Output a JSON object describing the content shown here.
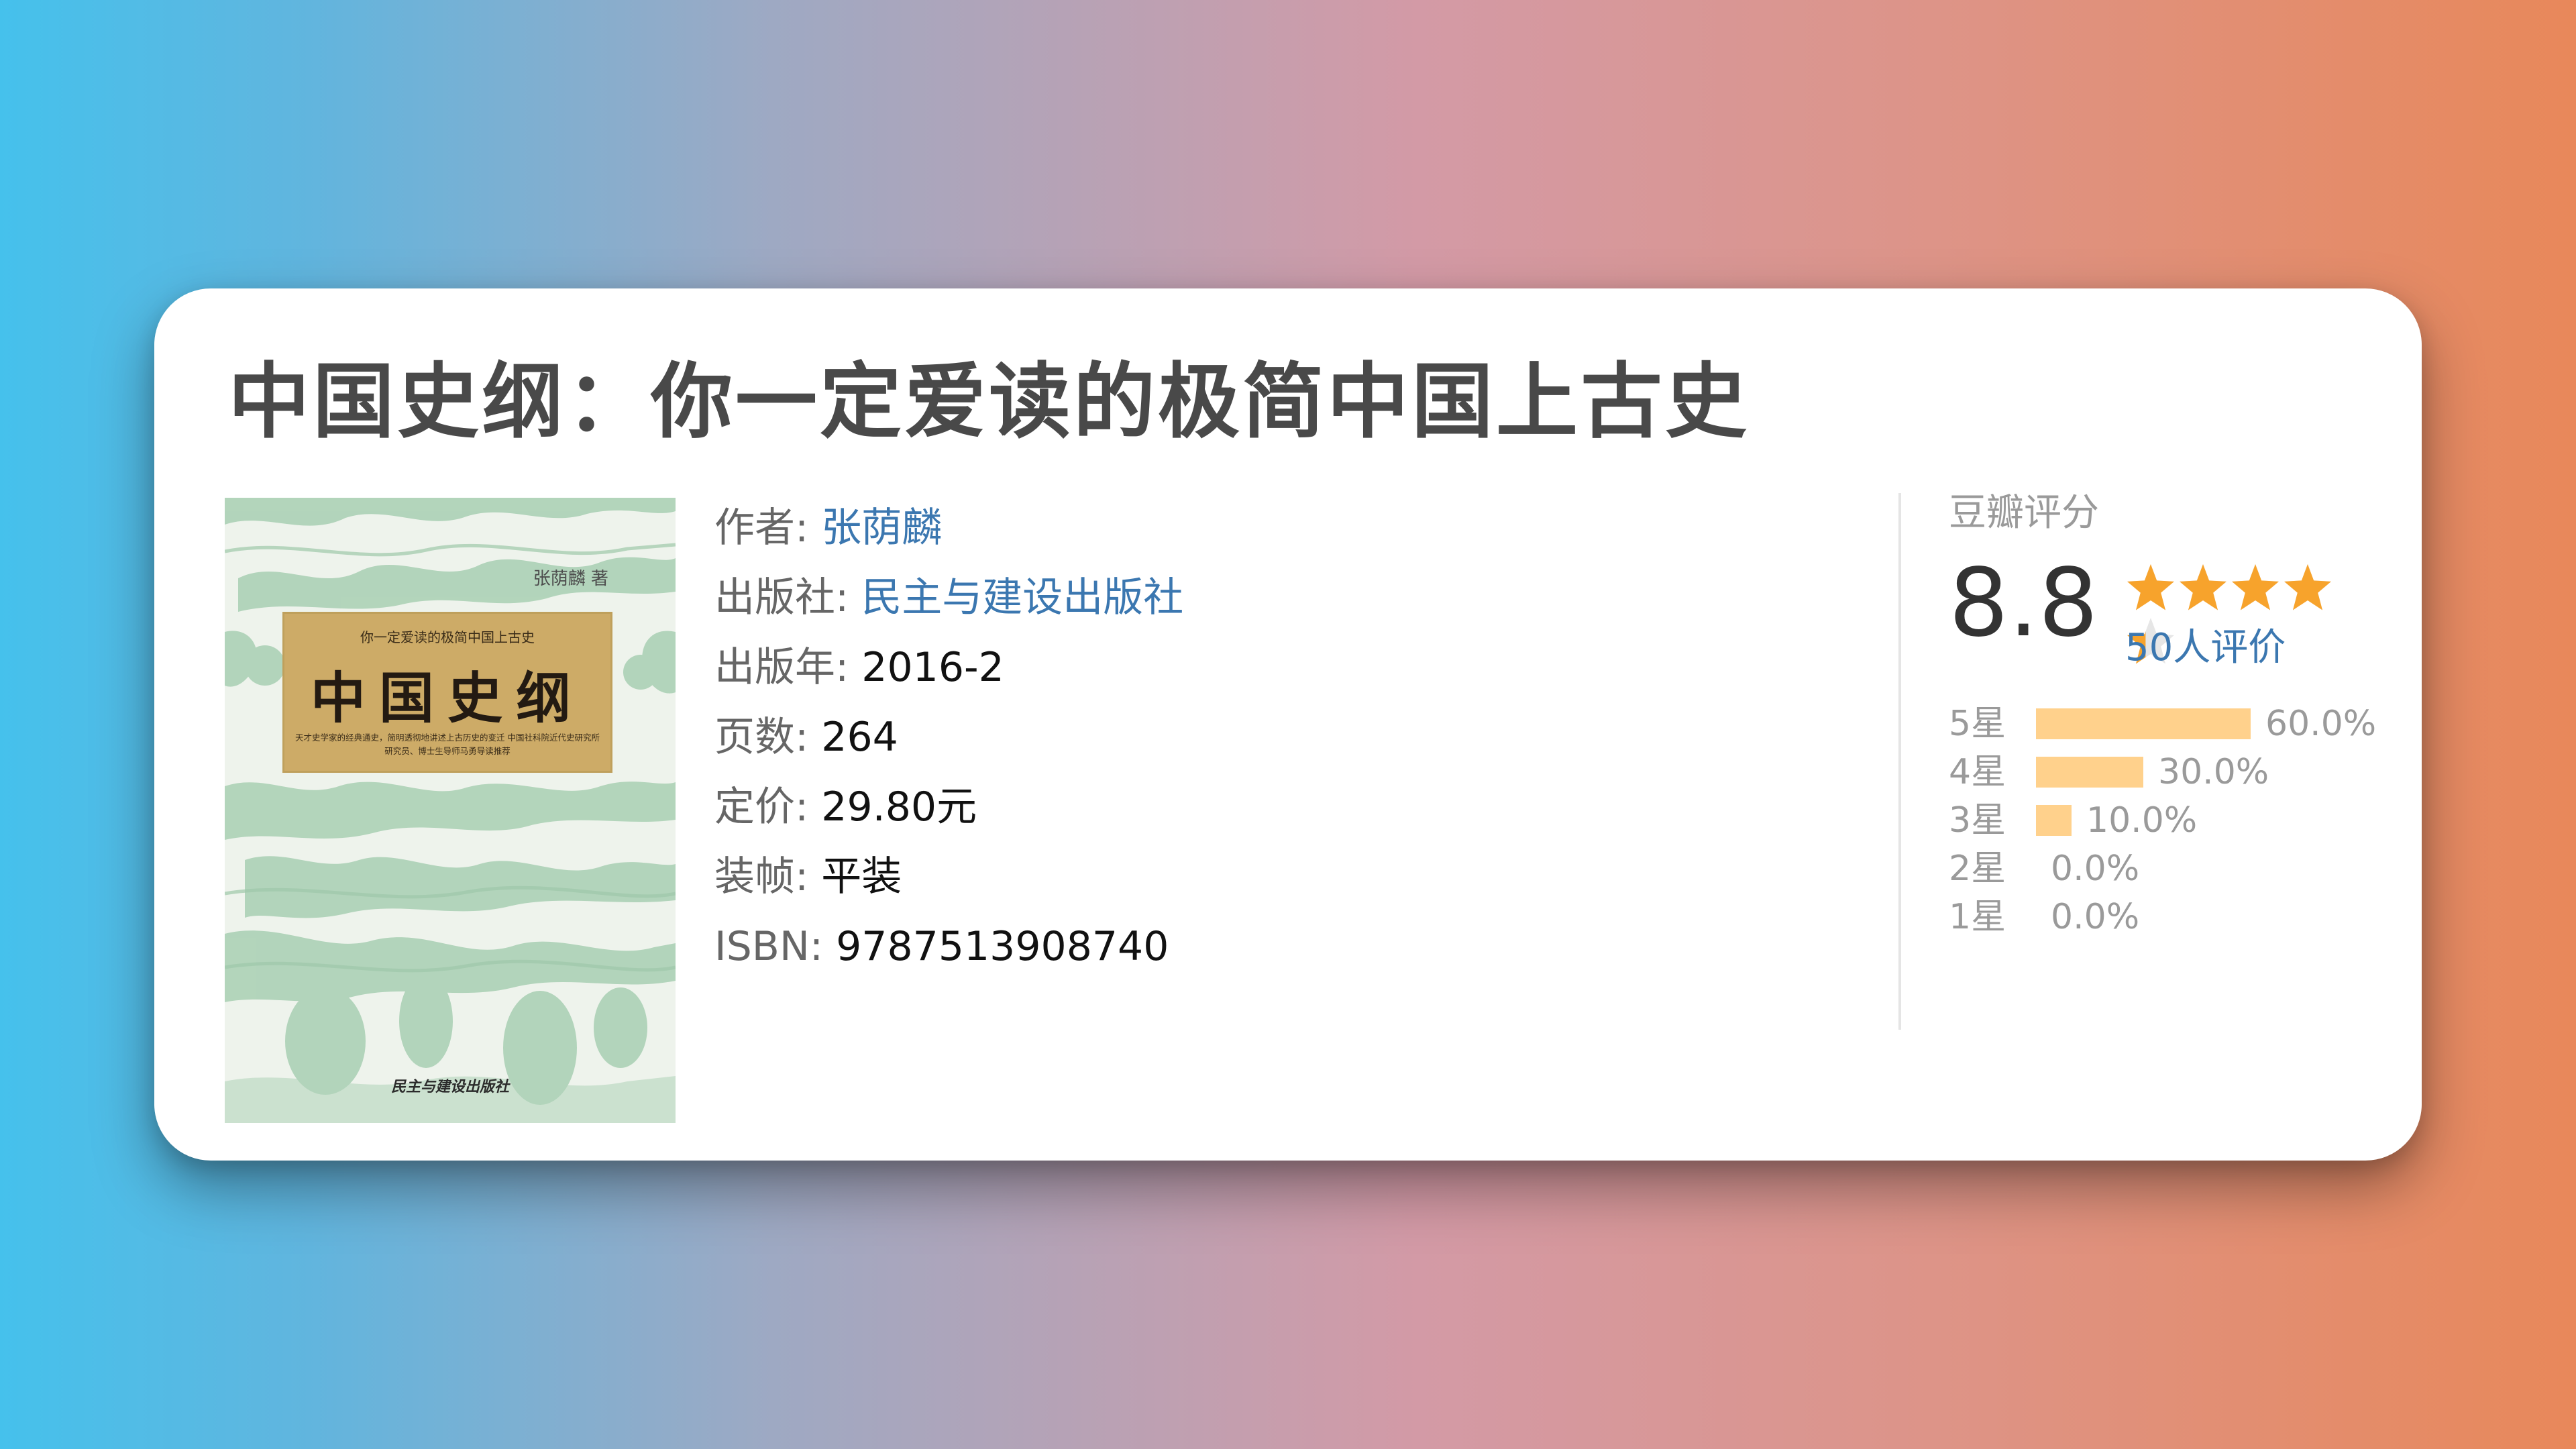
{
  "book": {
    "title": "中国史纲：你一定爱读的极简中国上古史",
    "author_label": "作者:",
    "author": "张荫麟",
    "publisher_label": "出版社:",
    "publisher": "民主与建设出版社",
    "year_label": "出版年:",
    "year": "2016-2",
    "pages_label": "页数:",
    "pages": "264",
    "price_label": "定价:",
    "price": "29.80元",
    "binding_label": "装帧:",
    "binding": "平装",
    "isbn_label": "ISBN:",
    "isbn": "9787513908740"
  },
  "cover": {
    "author_text": "张荫麟 著",
    "subtitle_text": "你一定爱读的极简中国上古史",
    "main_title": "中国史纲",
    "blurb": "天才史学家的经典通史，简明透彻地讲述上古历史的变迁 中国社科院近代史研究所研究员、博士生导师马勇导读推荐",
    "publisher_text": "民主与建设出版社"
  },
  "rating": {
    "label": "豆瓣评分",
    "score": "8.8",
    "star_fraction": 0.88,
    "votes": "50人评价",
    "star_color": "#f7a32c",
    "distribution": [
      {
        "label": "5星",
        "percent": "60.0%",
        "value": 60.0
      },
      {
        "label": "4星",
        "percent": "30.0%",
        "value": 30.0
      },
      {
        "label": "3星",
        "percent": "10.0%",
        "value": 10.0
      },
      {
        "label": "2星",
        "percent": "0.0%",
        "value": 0.0
      },
      {
        "label": "1星",
        "percent": "0.0%",
        "value": 0.0
      }
    ]
  },
  "colors": {
    "link": "#3b77b0",
    "bar": "#ffd18c"
  }
}
